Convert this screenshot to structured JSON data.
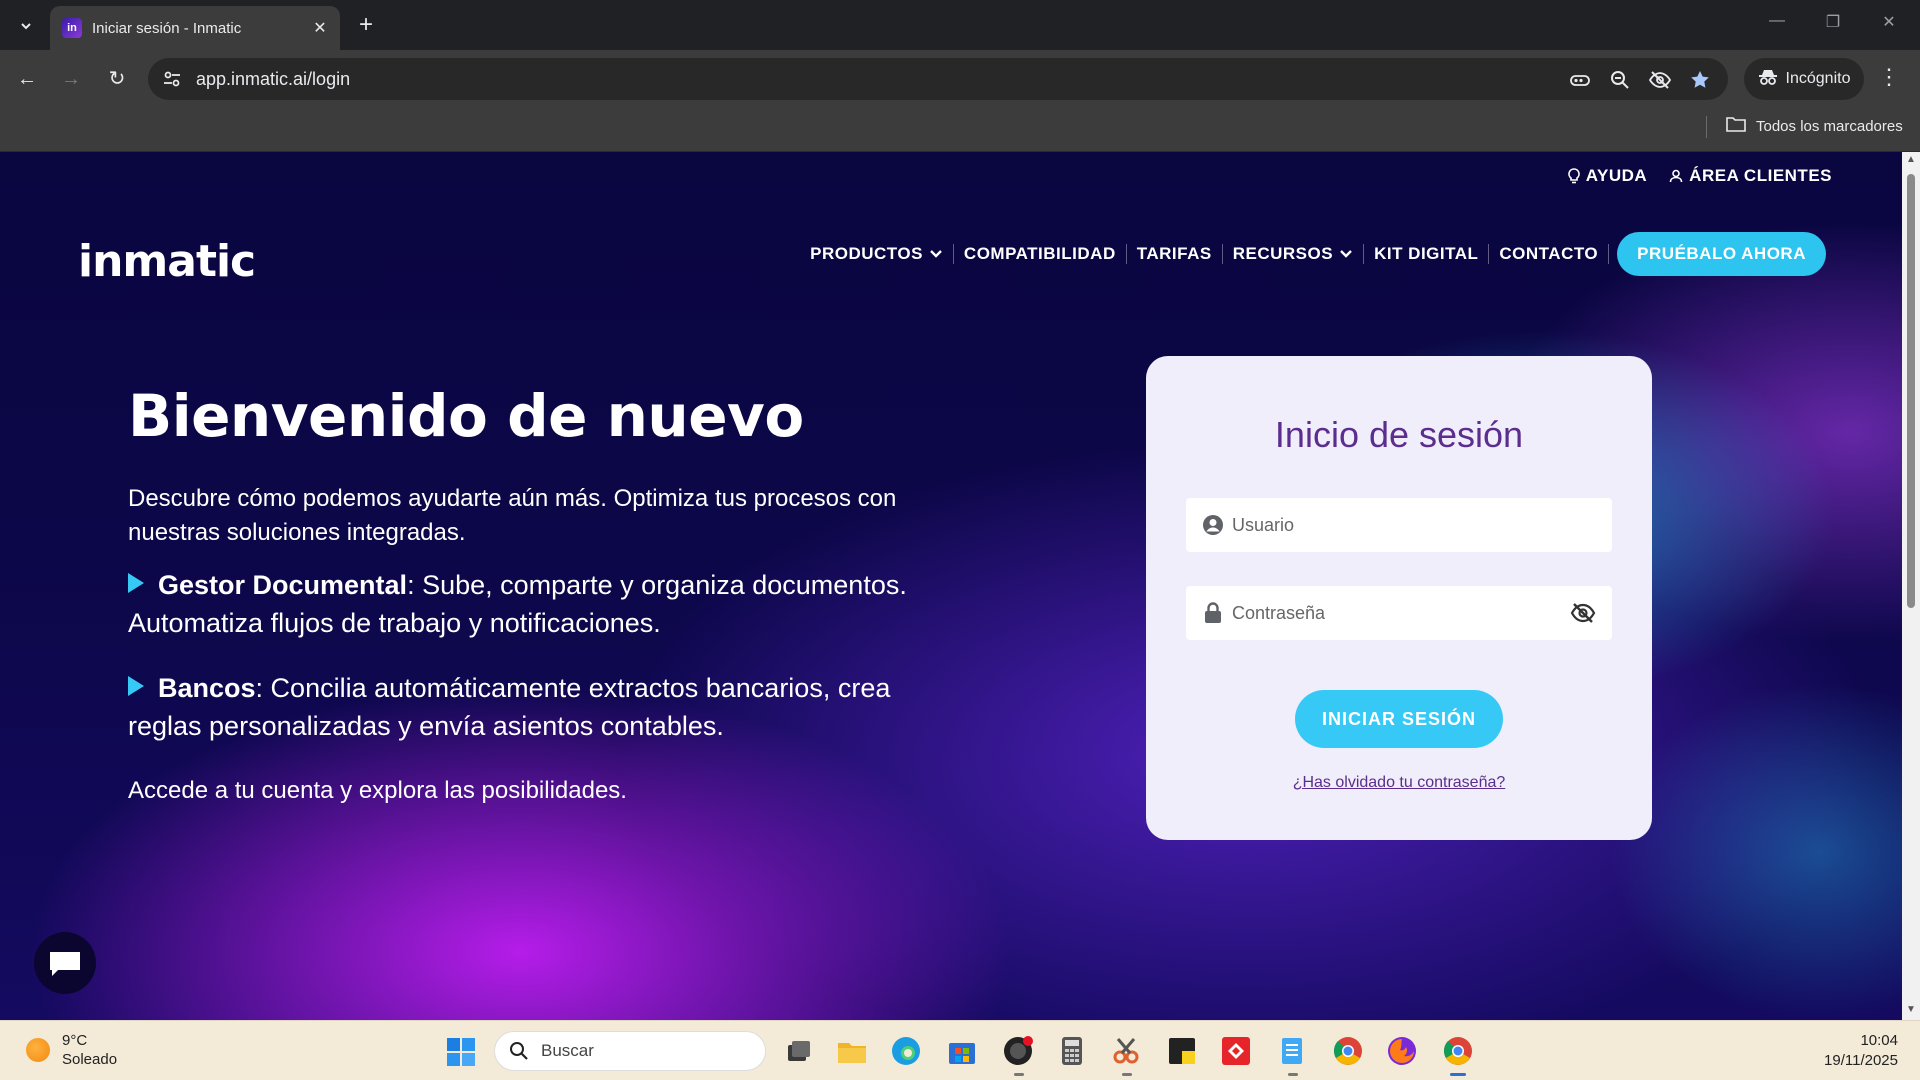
{
  "browser": {
    "tab_title": "Iniciar sesión - Inmatic",
    "url": "app.inmatic.ai/login",
    "incognito_label": "Incógnito",
    "bookmarks_all": "Todos los marcadores"
  },
  "site": {
    "logo_text": "inmatic",
    "top_links": {
      "help": "AYUDA",
      "clients": "ÁREA CLIENTES"
    },
    "nav": {
      "products": "PRODUCTOS",
      "compatibility": "COMPATIBILIDAD",
      "pricing": "TARIFAS",
      "resources": "RECURSOS",
      "kit": "KIT DIGITAL",
      "contact": "CONTACTO",
      "cta": "PRUÉBALO AHORA"
    },
    "hero": {
      "title": "Bienvenido de nuevo",
      "subtitle": "Descubre cómo podemos ayudarte aún más. Optimiza tus procesos con nuestras soluciones integradas.",
      "feature1_title": "Gestor Documental",
      "feature1_text": ": Sube, comparte y organiza documentos. Automatiza flujos de trabajo y notificaciones.",
      "feature2_title": "Bancos",
      "feature2_text": ": Concilia automáticamente extractos bancarios, crea reglas personalizadas y envía asientos contables.",
      "closing": "Accede a tu cuenta y explora las posibilidades."
    },
    "login": {
      "title": "Inicio de sesión",
      "user_placeholder": "Usuario",
      "user_value": "",
      "password_placeholder": "Contraseña",
      "password_value": "",
      "submit": "INICIAR SESIÓN",
      "forgot": "¿Has olvidado tu contraseña?"
    }
  },
  "taskbar": {
    "weather_temp": "9°C",
    "weather_desc": "Soleado",
    "search_placeholder": "Buscar",
    "time": "10:04",
    "date": "19/11/2025"
  },
  "colors": {
    "accent": "#36c9f5",
    "brand_purple": "#5b2d8e",
    "page_dark": "#0c0748"
  }
}
